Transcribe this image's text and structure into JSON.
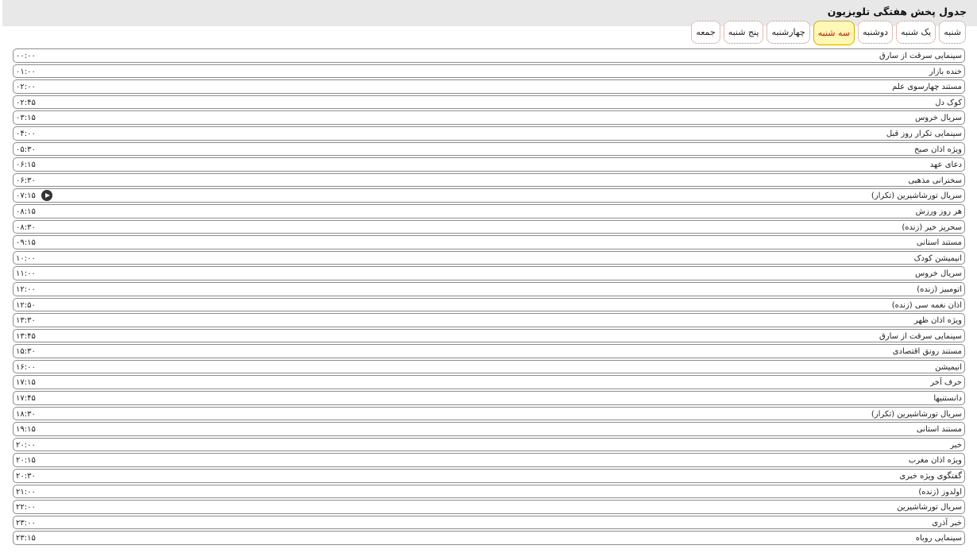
{
  "header": {
    "title": "جدول پخش هفتگی تلویزیون"
  },
  "tabs": [
    {
      "label": "شنبه",
      "active": false
    },
    {
      "label": "یک شنبه",
      "active": false
    },
    {
      "label": "دوشنبه",
      "active": false
    },
    {
      "label": "سه شنبه",
      "active": true
    },
    {
      "label": "چهارشنبه",
      "active": false
    },
    {
      "label": "پنج شنبه",
      "active": false
    },
    {
      "label": "جمعه",
      "active": false
    }
  ],
  "schedule": [
    {
      "time": "۰۰:۰۰",
      "title": "سینمایی سرقت از سارق"
    },
    {
      "time": "۰۱:۰۰",
      "title": "خنده بازار"
    },
    {
      "time": "۰۲:۰۰",
      "title": "مستند چهارسوی علم"
    },
    {
      "time": "۰۲:۴۵",
      "title": "کوک دل"
    },
    {
      "time": "۰۳:۱۵",
      "title": "سریال خروس"
    },
    {
      "time": "۰۴:۰۰",
      "title": "سینمایی تکرار روز قبل"
    },
    {
      "time": "۰۵:۳۰",
      "title": "ویژه اذان صبح"
    },
    {
      "time": "۰۶:۱۵",
      "title": "دعای عهد"
    },
    {
      "time": "۰۶:۳۰",
      "title": "سخنرانی مذهبی"
    },
    {
      "time": "۰۷:۱۵",
      "title": "سریال تورشاشیرین (تکرار)",
      "now_playing": true
    },
    {
      "time": "۰۸:۱۵",
      "title": "هر روز ورزش"
    },
    {
      "time": "۰۸:۳۰",
      "title": "سحرپز خیر (زنده)"
    },
    {
      "time": "۰۹:۱۵",
      "title": "مستند استانی"
    },
    {
      "time": "۱۰:۰۰",
      "title": "انیمیشن کودک"
    },
    {
      "time": "۱۱:۰۰",
      "title": "سریال خروس"
    },
    {
      "time": "۱۲:۰۰",
      "title": "اتومبیز (زنده)"
    },
    {
      "time": "۱۲:۵۰",
      "title": "اذان نغمه سی (زنده)"
    },
    {
      "time": "۱۳:۳۰",
      "title": "ویژه اذان ظهر"
    },
    {
      "time": "۱۳:۴۵",
      "title": "سینمایی سرقت از سارق"
    },
    {
      "time": "۱۵:۳۰",
      "title": "مستند رونق اقتصادی"
    },
    {
      "time": "۱۶:۰۰",
      "title": "انیمیشن"
    },
    {
      "time": "۱۷:۱۵",
      "title": "حرف آخر"
    },
    {
      "time": "۱۷:۴۵",
      "title": "دانستنیها"
    },
    {
      "time": "۱۸:۳۰",
      "title": "سریال تورشاشیرین (تکرار)"
    },
    {
      "time": "۱۹:۱۵",
      "title": "مستند استانی"
    },
    {
      "time": "۲۰:۰۰",
      "title": "خبر"
    },
    {
      "time": "۲۰:۱۵",
      "title": "ویژه اذان مغرب"
    },
    {
      "time": "۲۰:۳۰",
      "title": "گفتگوی ویژه خبری"
    },
    {
      "time": "۲۱:۰۰",
      "title": "اولدوز (زنده)"
    },
    {
      "time": "۲۲:۰۰",
      "title": "سریال تورشاشیرین"
    },
    {
      "time": "۲۳:۰۰",
      "title": "خبر آذری"
    },
    {
      "time": "۲۳:۱۵",
      "title": "سینمایی روباه"
    }
  ]
}
